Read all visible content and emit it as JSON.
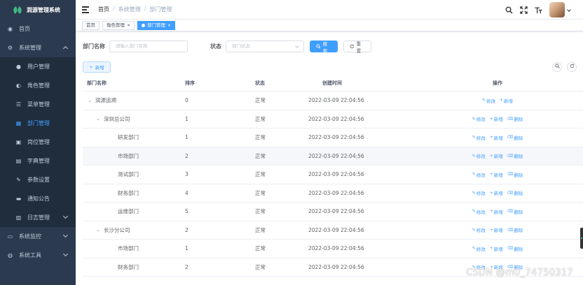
{
  "app": {
    "title": "润源管理系统",
    "brand_color": "#409eff",
    "sidebar_bg": "#2b3a4e"
  },
  "sidebar": {
    "items": [
      {
        "label": "首页",
        "icon": "dashboard-icon",
        "level": 0,
        "active": false
      },
      {
        "label": "系统管理",
        "icon": "gear-icon",
        "level": 0,
        "active": false,
        "expanded": true
      },
      {
        "label": "用户管理",
        "icon": "user-icon",
        "level": 1,
        "active": false
      },
      {
        "label": "角色管理",
        "icon": "peoples-icon",
        "level": 1,
        "active": false
      },
      {
        "label": "菜单管理",
        "icon": "tree-table-icon",
        "level": 1,
        "active": false
      },
      {
        "label": "部门管理",
        "icon": "tree-icon",
        "level": 1,
        "active": true
      },
      {
        "label": "岗位管理",
        "icon": "post-icon",
        "level": 1,
        "active": false
      },
      {
        "label": "字典管理",
        "icon": "dict-icon",
        "level": 1,
        "active": false
      },
      {
        "label": "参数设置",
        "icon": "edit-icon",
        "level": 1,
        "active": false
      },
      {
        "label": "通知公告",
        "icon": "message-icon",
        "level": 1,
        "active": false
      },
      {
        "label": "日志管理",
        "icon": "log-icon",
        "level": 1,
        "active": false,
        "has_children": true
      },
      {
        "label": "系统监控",
        "icon": "monitor-icon",
        "level": 0,
        "active": false,
        "has_children": true
      },
      {
        "label": "系统工具",
        "icon": "tool-icon",
        "level": 0,
        "active": false,
        "has_children": true
      }
    ]
  },
  "navbar": {
    "breadcrumb": [
      "首页",
      "系统管理",
      "部门管理"
    ],
    "icons": [
      "search-icon",
      "fullscreen-icon",
      "font-size-icon"
    ]
  },
  "tags": [
    {
      "label": "首页",
      "active": false,
      "closable": false
    },
    {
      "label": "角色管理",
      "active": false,
      "closable": true
    },
    {
      "label": "部门管理",
      "active": true,
      "closable": true
    }
  ],
  "search": {
    "dept_label": "部门名称",
    "dept_placeholder": "请输入部门名称",
    "status_label": "状态",
    "status_placeholder": "部门状态",
    "search_button": "搜索",
    "reset_button": "重置"
  },
  "toolbar": {
    "add_button": "新增"
  },
  "table": {
    "headers": {
      "name": "部门名称",
      "sort": "排序",
      "status": "状态",
      "time": "创建时间",
      "ops": "操作"
    },
    "op_labels": {
      "edit": "修改",
      "add": "新增",
      "delete": "删除"
    },
    "rows": [
      {
        "name": "润源追溯",
        "sort": "0",
        "status": "正常",
        "time": "2022-03-09 22:04:56",
        "level": 0,
        "expander": "open",
        "deletable": false
      },
      {
        "name": "深圳总公司",
        "sort": "1",
        "status": "正常",
        "time": "2022-03-09 22:04:56",
        "level": 1,
        "expander": "open",
        "deletable": true
      },
      {
        "name": "研发部门",
        "sort": "1",
        "status": "正常",
        "time": "2022-03-09 22:04:56",
        "level": 2,
        "expander": "none",
        "deletable": true
      },
      {
        "name": "市场部门",
        "sort": "2",
        "status": "正常",
        "time": "2022-03-09 22:04:56",
        "level": 2,
        "expander": "none",
        "deletable": true
      },
      {
        "name": "测试部门",
        "sort": "3",
        "status": "正常",
        "time": "2022-03-09 22:04:56",
        "level": 2,
        "expander": "none",
        "deletable": true
      },
      {
        "name": "财务部门",
        "sort": "4",
        "status": "正常",
        "time": "2022-03-09 22:04:56",
        "level": 2,
        "expander": "none",
        "deletable": true
      },
      {
        "name": "运维部门",
        "sort": "5",
        "status": "正常",
        "time": "2022-03-09 22:04:56",
        "level": 2,
        "expander": "none",
        "deletable": true
      },
      {
        "name": "长沙分公司",
        "sort": "2",
        "status": "正常",
        "time": "2022-03-09 22:04:56",
        "level": 1,
        "expander": "open",
        "deletable": true
      },
      {
        "name": "市场部门",
        "sort": "1",
        "status": "正常",
        "time": "2022-03-09 22:04:56",
        "level": 2,
        "expander": "none",
        "deletable": true
      },
      {
        "name": "财务部门",
        "sort": "2",
        "status": "正常",
        "time": "2022-03-09 22:04:56",
        "level": 2,
        "expander": "none",
        "deletable": true
      }
    ]
  },
  "watermark": "CSDN @m0_74750317"
}
